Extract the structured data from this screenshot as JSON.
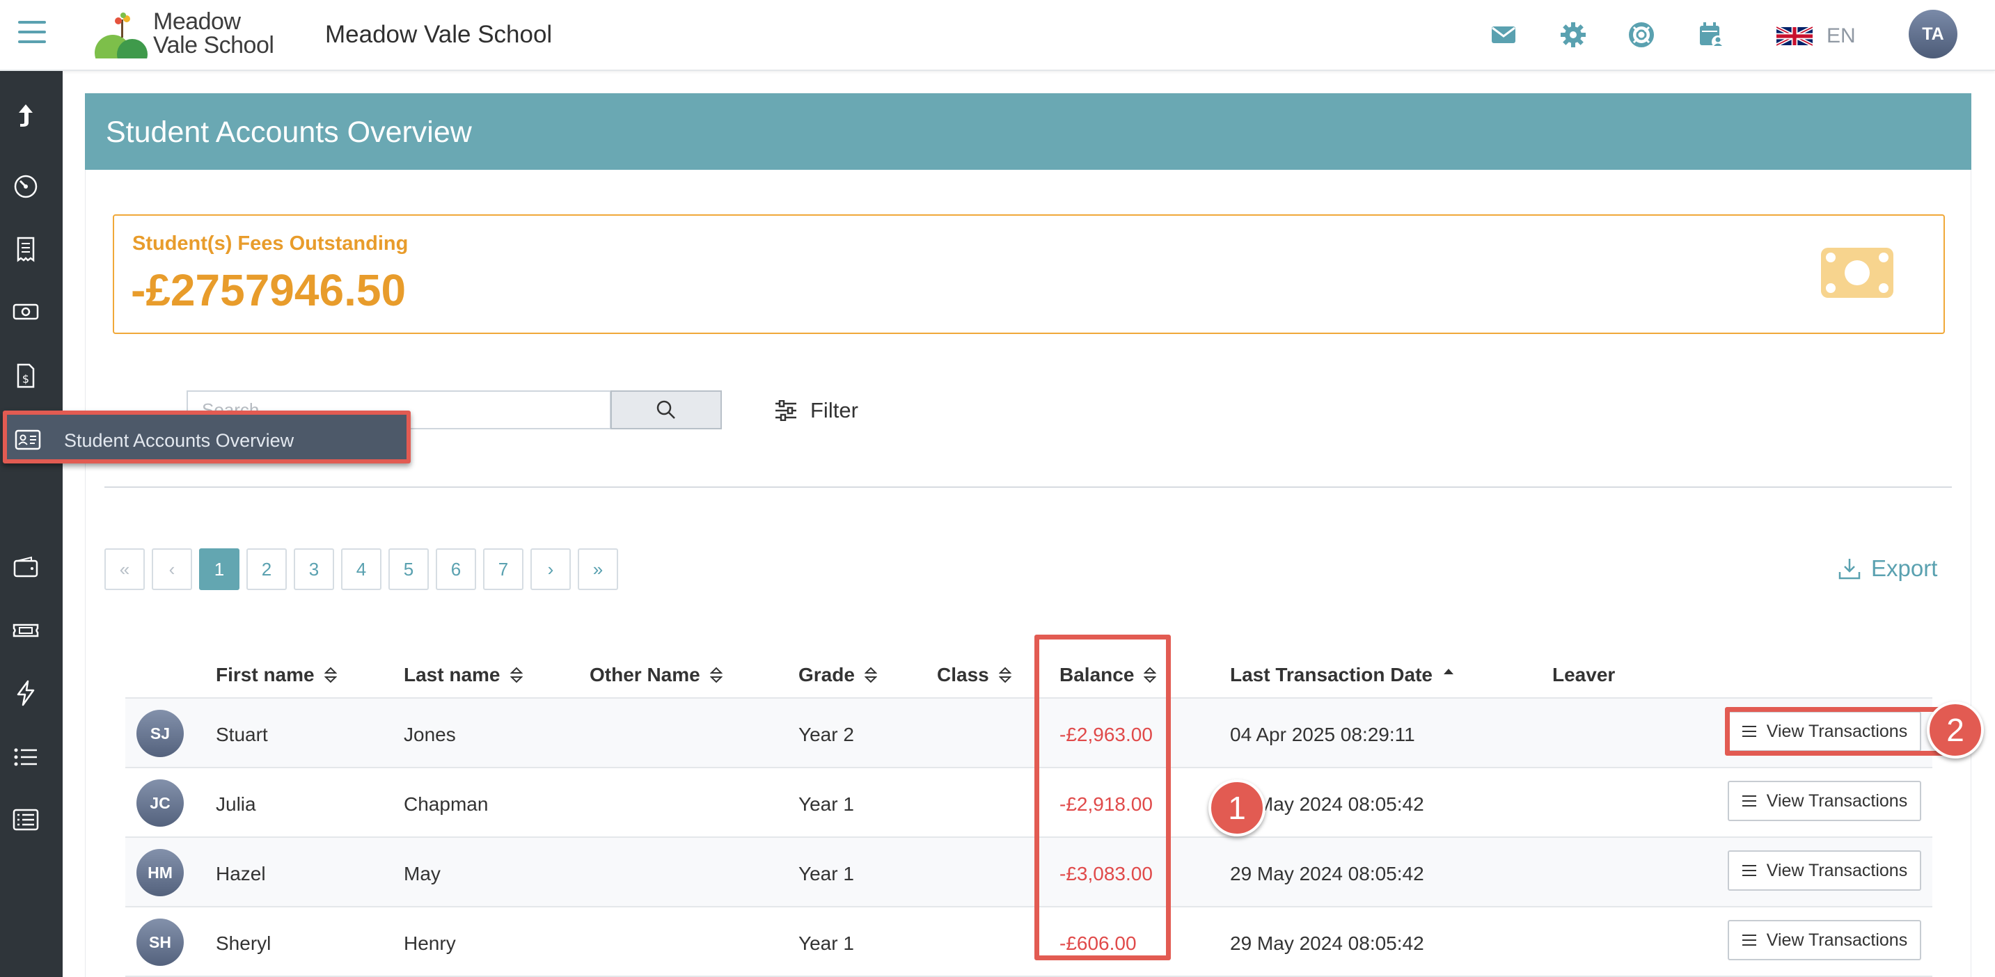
{
  "header": {
    "logo_line1": "Meadow",
    "logo_line2": "Vale School",
    "school_name": "Meadow Vale School",
    "language": "EN",
    "user_initials": "TA"
  },
  "sidebar": {
    "tooltip": "Student Accounts Overview"
  },
  "page": {
    "title": "Student Accounts Overview",
    "fees_label": "Student(s) Fees Outstanding",
    "fees_value": "-£2757946.50"
  },
  "search": {
    "placeholder": "Search"
  },
  "filter_label": "Filter",
  "export_label": "Export",
  "pagination": {
    "first": "«",
    "prev": "‹",
    "pages": [
      "1",
      "2",
      "3",
      "4",
      "5",
      "6",
      "7"
    ],
    "next": "›",
    "last": "»",
    "current": "1"
  },
  "table": {
    "columns": [
      "First name",
      "Last name",
      "Other Name",
      "Grade",
      "Class",
      "Balance",
      "Last Transaction Date",
      "Leaver"
    ],
    "rows": [
      {
        "initials": "SJ",
        "first": "Stuart",
        "last": "Jones",
        "other": "",
        "grade": "Year 2",
        "class": "",
        "balance": "-£2,963.00",
        "date": "04 Apr 2025 08:29:11",
        "leaver": "",
        "action": "View Transactions"
      },
      {
        "initials": "JC",
        "first": "Julia",
        "last": "Chapman",
        "other": "",
        "grade": "Year 1",
        "class": "",
        "balance": "-£2,918.00",
        "date": "29 May 2024 08:05:42",
        "leaver": "",
        "action": "View Transactions"
      },
      {
        "initials": "HM",
        "first": "Hazel",
        "last": "May",
        "other": "",
        "grade": "Year 1",
        "class": "",
        "balance": "-£3,083.00",
        "date": "29 May 2024 08:05:42",
        "leaver": "",
        "action": "View Transactions"
      },
      {
        "initials": "SH",
        "first": "Sheryl",
        "last": "Henry",
        "other": "",
        "grade": "Year 1",
        "class": "",
        "balance": "-£606.00",
        "date": "29 May 2024 08:05:42",
        "leaver": "",
        "action": "View Transactions"
      }
    ]
  },
  "annotations": {
    "badge1": "1",
    "badge2": "2"
  },
  "colors": {
    "accent": "#63a6b1",
    "header_band": "#6aa8b3",
    "sidebar": "#2f353a",
    "fees_orange": "#e89c2b",
    "negative_red": "#e04a4a",
    "annotation_red": "#e25b52"
  }
}
